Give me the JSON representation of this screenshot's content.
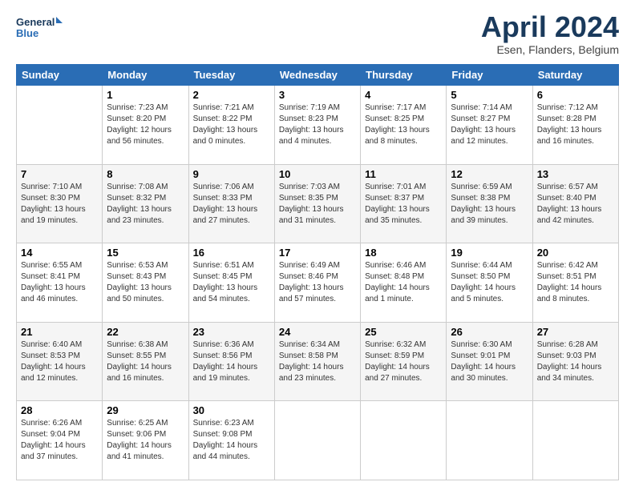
{
  "header": {
    "logo_line1": "General",
    "logo_line2": "Blue",
    "month": "April 2024",
    "location": "Esen, Flanders, Belgium"
  },
  "days_of_week": [
    "Sunday",
    "Monday",
    "Tuesday",
    "Wednesday",
    "Thursday",
    "Friday",
    "Saturday"
  ],
  "weeks": [
    {
      "cells": [
        {
          "day": "",
          "info": ""
        },
        {
          "day": "1",
          "info": "Sunrise: 7:23 AM\nSunset: 8:20 PM\nDaylight: 12 hours\nand 56 minutes."
        },
        {
          "day": "2",
          "info": "Sunrise: 7:21 AM\nSunset: 8:22 PM\nDaylight: 13 hours\nand 0 minutes."
        },
        {
          "day": "3",
          "info": "Sunrise: 7:19 AM\nSunset: 8:23 PM\nDaylight: 13 hours\nand 4 minutes."
        },
        {
          "day": "4",
          "info": "Sunrise: 7:17 AM\nSunset: 8:25 PM\nDaylight: 13 hours\nand 8 minutes."
        },
        {
          "day": "5",
          "info": "Sunrise: 7:14 AM\nSunset: 8:27 PM\nDaylight: 13 hours\nand 12 minutes."
        },
        {
          "day": "6",
          "info": "Sunrise: 7:12 AM\nSunset: 8:28 PM\nDaylight: 13 hours\nand 16 minutes."
        }
      ]
    },
    {
      "cells": [
        {
          "day": "7",
          "info": "Sunrise: 7:10 AM\nSunset: 8:30 PM\nDaylight: 13 hours\nand 19 minutes."
        },
        {
          "day": "8",
          "info": "Sunrise: 7:08 AM\nSunset: 8:32 PM\nDaylight: 13 hours\nand 23 minutes."
        },
        {
          "day": "9",
          "info": "Sunrise: 7:06 AM\nSunset: 8:33 PM\nDaylight: 13 hours\nand 27 minutes."
        },
        {
          "day": "10",
          "info": "Sunrise: 7:03 AM\nSunset: 8:35 PM\nDaylight: 13 hours\nand 31 minutes."
        },
        {
          "day": "11",
          "info": "Sunrise: 7:01 AM\nSunset: 8:37 PM\nDaylight: 13 hours\nand 35 minutes."
        },
        {
          "day": "12",
          "info": "Sunrise: 6:59 AM\nSunset: 8:38 PM\nDaylight: 13 hours\nand 39 minutes."
        },
        {
          "day": "13",
          "info": "Sunrise: 6:57 AM\nSunset: 8:40 PM\nDaylight: 13 hours\nand 42 minutes."
        }
      ]
    },
    {
      "cells": [
        {
          "day": "14",
          "info": "Sunrise: 6:55 AM\nSunset: 8:41 PM\nDaylight: 13 hours\nand 46 minutes."
        },
        {
          "day": "15",
          "info": "Sunrise: 6:53 AM\nSunset: 8:43 PM\nDaylight: 13 hours\nand 50 minutes."
        },
        {
          "day": "16",
          "info": "Sunrise: 6:51 AM\nSunset: 8:45 PM\nDaylight: 13 hours\nand 54 minutes."
        },
        {
          "day": "17",
          "info": "Sunrise: 6:49 AM\nSunset: 8:46 PM\nDaylight: 13 hours\nand 57 minutes."
        },
        {
          "day": "18",
          "info": "Sunrise: 6:46 AM\nSunset: 8:48 PM\nDaylight: 14 hours\nand 1 minute."
        },
        {
          "day": "19",
          "info": "Sunrise: 6:44 AM\nSunset: 8:50 PM\nDaylight: 14 hours\nand 5 minutes."
        },
        {
          "day": "20",
          "info": "Sunrise: 6:42 AM\nSunset: 8:51 PM\nDaylight: 14 hours\nand 8 minutes."
        }
      ]
    },
    {
      "cells": [
        {
          "day": "21",
          "info": "Sunrise: 6:40 AM\nSunset: 8:53 PM\nDaylight: 14 hours\nand 12 minutes."
        },
        {
          "day": "22",
          "info": "Sunrise: 6:38 AM\nSunset: 8:55 PM\nDaylight: 14 hours\nand 16 minutes."
        },
        {
          "day": "23",
          "info": "Sunrise: 6:36 AM\nSunset: 8:56 PM\nDaylight: 14 hours\nand 19 minutes."
        },
        {
          "day": "24",
          "info": "Sunrise: 6:34 AM\nSunset: 8:58 PM\nDaylight: 14 hours\nand 23 minutes."
        },
        {
          "day": "25",
          "info": "Sunrise: 6:32 AM\nSunset: 8:59 PM\nDaylight: 14 hours\nand 27 minutes."
        },
        {
          "day": "26",
          "info": "Sunrise: 6:30 AM\nSunset: 9:01 PM\nDaylight: 14 hours\nand 30 minutes."
        },
        {
          "day": "27",
          "info": "Sunrise: 6:28 AM\nSunset: 9:03 PM\nDaylight: 14 hours\nand 34 minutes."
        }
      ]
    },
    {
      "cells": [
        {
          "day": "28",
          "info": "Sunrise: 6:26 AM\nSunset: 9:04 PM\nDaylight: 14 hours\nand 37 minutes."
        },
        {
          "day": "29",
          "info": "Sunrise: 6:25 AM\nSunset: 9:06 PM\nDaylight: 14 hours\nand 41 minutes."
        },
        {
          "day": "30",
          "info": "Sunrise: 6:23 AM\nSunset: 9:08 PM\nDaylight: 14 hours\nand 44 minutes."
        },
        {
          "day": "",
          "info": ""
        },
        {
          "day": "",
          "info": ""
        },
        {
          "day": "",
          "info": ""
        },
        {
          "day": "",
          "info": ""
        }
      ]
    }
  ]
}
